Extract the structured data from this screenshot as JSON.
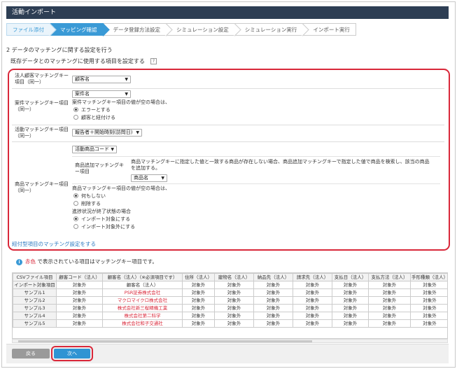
{
  "title": "活動インポート",
  "steps": [
    {
      "label": "ファイル添付",
      "state": "done"
    },
    {
      "label": "マッピング確認",
      "state": "active"
    },
    {
      "label": "データ登録方法設定",
      "state": ""
    },
    {
      "label": "シミュレーション設定",
      "state": ""
    },
    {
      "label": "シミュレーション実行",
      "state": ""
    },
    {
      "label": "インポート実行",
      "state": ""
    }
  ],
  "section_title": "2 データのマッチングに関する設定を行う",
  "subsection_title": "既存データとのマッチングに使用する項目を設定する",
  "help_icon": "?",
  "settings": {
    "corp": {
      "label": "法人顧客マッチングキー項目（同一）",
      "select": "顧客名"
    },
    "deal": {
      "label": "案件マッチングキー項目（同一）",
      "select": "案件名",
      "note": "案件マッチングキー項目の値が空の場合は、",
      "opt1": "エラーとする",
      "opt2": "顧客と紐付ける"
    },
    "activity": {
      "label": "活動マッチングキー項目（同一）",
      "select": "報告者＋開始時刻(訪問日)"
    },
    "product": {
      "label": "商品マッチングキー項目（同一）",
      "select": "活動商品コード",
      "add_label": "商品追加マッチングキー項目",
      "add_note1": "商品マッチングキーに指定した値と一致する商品が存在しない場合、商品追加マッチングキーで指定した値で商品を検索し、該当の商品",
      "add_note2": "を追加する。",
      "add_select": "商品名",
      "empty_note": "商品マッチングキー項目の値が空の場合は、",
      "opt1": "何もしない",
      "opt2": "削除する",
      "progress_note": "進捗状況が終了状態の場合",
      "opt3": "インポート対象にする",
      "opt4": "インポート対象外にする"
    }
  },
  "linked_link": "紐付型項目のマッチング設定をする",
  "info": {
    "icon": "i",
    "red_word": "赤色",
    "rest": " で表示されている項目はマッチングキー項目です。"
  },
  "table": {
    "headers": [
      "CSVファイル項目",
      "顧客コード（法人）",
      "顧客名（法人）（※必須項目です）",
      "住所（法人）",
      "建物名（法人）",
      "納品先（法人）",
      "請求先（法人）",
      "支払日（法人）",
      "支払方法（法人）",
      "手形種類（法人）"
    ],
    "row2": [
      "インポート対象項目",
      "対象外",
      "顧客名（法人）",
      "対象外",
      "対象外",
      "対象外",
      "対象外",
      "対象外",
      "対象外",
      "対象外"
    ],
    "rows": [
      [
        "サンプル1",
        "対象外",
        "PSR証券株式会社",
        "対象外",
        "対象外",
        "対象外",
        "対象外",
        "対象外",
        "対象外",
        "対象外"
      ],
      [
        "サンプル2",
        "対象外",
        "マクロマイクロ株式会社",
        "対象外",
        "対象外",
        "対象外",
        "対象外",
        "対象外",
        "対象外",
        "対象外"
      ],
      [
        "サンプル3",
        "対象外",
        "株式会社新三桜精機工業",
        "対象外",
        "対象外",
        "対象外",
        "対象外",
        "対象外",
        "対象外",
        "対象外"
      ],
      [
        "サンプル4",
        "対象外",
        "株式会社第二科学",
        "対象外",
        "対象外",
        "対象外",
        "対象外",
        "対象外",
        "対象外",
        "対象外"
      ],
      [
        "サンプル5",
        "対象外",
        "株式会社和子交通社",
        "対象外",
        "対象外",
        "対象外",
        "対象外",
        "対象外",
        "対象外",
        "対象外"
      ]
    ]
  },
  "buttons": {
    "back": "戻る",
    "next": "次へ"
  },
  "colors": {
    "header_bg": "#2d3e54",
    "accent": "#3a9ad6",
    "highlight": "#d9283a"
  }
}
